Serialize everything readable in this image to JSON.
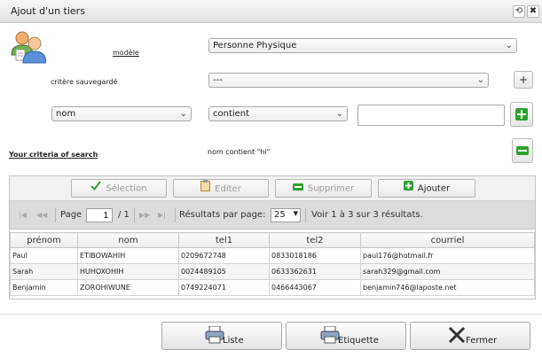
{
  "window": {
    "title": "Ajout d'un tiers",
    "restore_glyph": "⟲",
    "close_glyph": "✖"
  },
  "form": {
    "modele_label": "modèle",
    "modele_value": "Personne Physique",
    "critere_label": "critère sauvegardé",
    "critere_value": "---",
    "critere_add": "+",
    "field_value": "nom",
    "operator_value": "contient",
    "search_value": "",
    "criteria_link": "Your criteria of search",
    "criteria_text": "nom contient \"hi\"",
    "dropdown_glyph": "⌄"
  },
  "toolbar": {
    "selection": "Sélection",
    "editer": "Editer",
    "supprimer": "Supprimer",
    "ajouter": "Ajouter"
  },
  "pager": {
    "first": "|◀",
    "prev": "◀◀",
    "page_label": "Page",
    "page_value": "1",
    "of_label": "/ 1",
    "next": "▶▶",
    "last": "▶|",
    "results_label": "Résultats par page:",
    "per_page": "25",
    "summary": "Voir 1 à 3 sur 3 résultats."
  },
  "grid": {
    "columns": [
      "prénom",
      "nom",
      "tel1",
      "tel2",
      "courriel"
    ],
    "rows": [
      [
        "Paul",
        "ETIBOWAHIH",
        "0209672748",
        "0833018186",
        "paul176@hotmail.fr"
      ],
      [
        "Sarah",
        "HUHOXOHIH",
        "0024489105",
        "0633362631",
        "sarah329@gmail.com"
      ],
      [
        "Benjamin",
        "ZOROHIWUNE",
        "0749224071",
        "0466443067",
        "benjamin746@laposte.net"
      ]
    ]
  },
  "footer": {
    "liste": "Liste",
    "etiquette": "Etiquette",
    "fermer": "Fermer"
  },
  "colors": {
    "accent_green": "#2ea12e",
    "check_green": "#3a9a3a"
  }
}
